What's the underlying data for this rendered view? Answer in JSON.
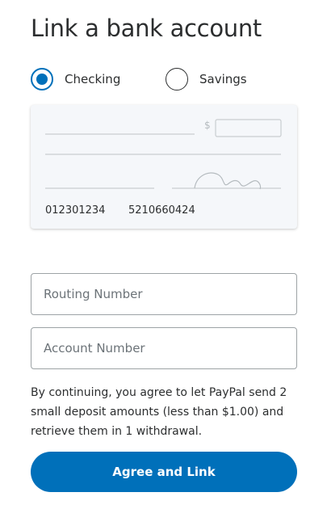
{
  "page": {
    "title": "Link a bank account"
  },
  "account_type": {
    "options": [
      {
        "label": "Checking",
        "selected": true
      },
      {
        "label": "Savings",
        "selected": false
      }
    ]
  },
  "check_illustration": {
    "currency_symbol": "$",
    "routing_number": "012301234",
    "account_number": "5210660424"
  },
  "form": {
    "routing_placeholder": "Routing Number",
    "account_placeholder": "Account Number",
    "routing_value": "",
    "account_value": ""
  },
  "disclaimer": "By continuing, you agree to let PayPal send 2 small deposit amounts (less than $1.00) and retrieve them in 1 withdrawal.",
  "actions": {
    "agree_label": "Agree and Link"
  },
  "colors": {
    "accent": "#0070ba",
    "text": "#2c2e2f",
    "card_bg": "#f5f7fa",
    "border": "#9da3a6"
  }
}
